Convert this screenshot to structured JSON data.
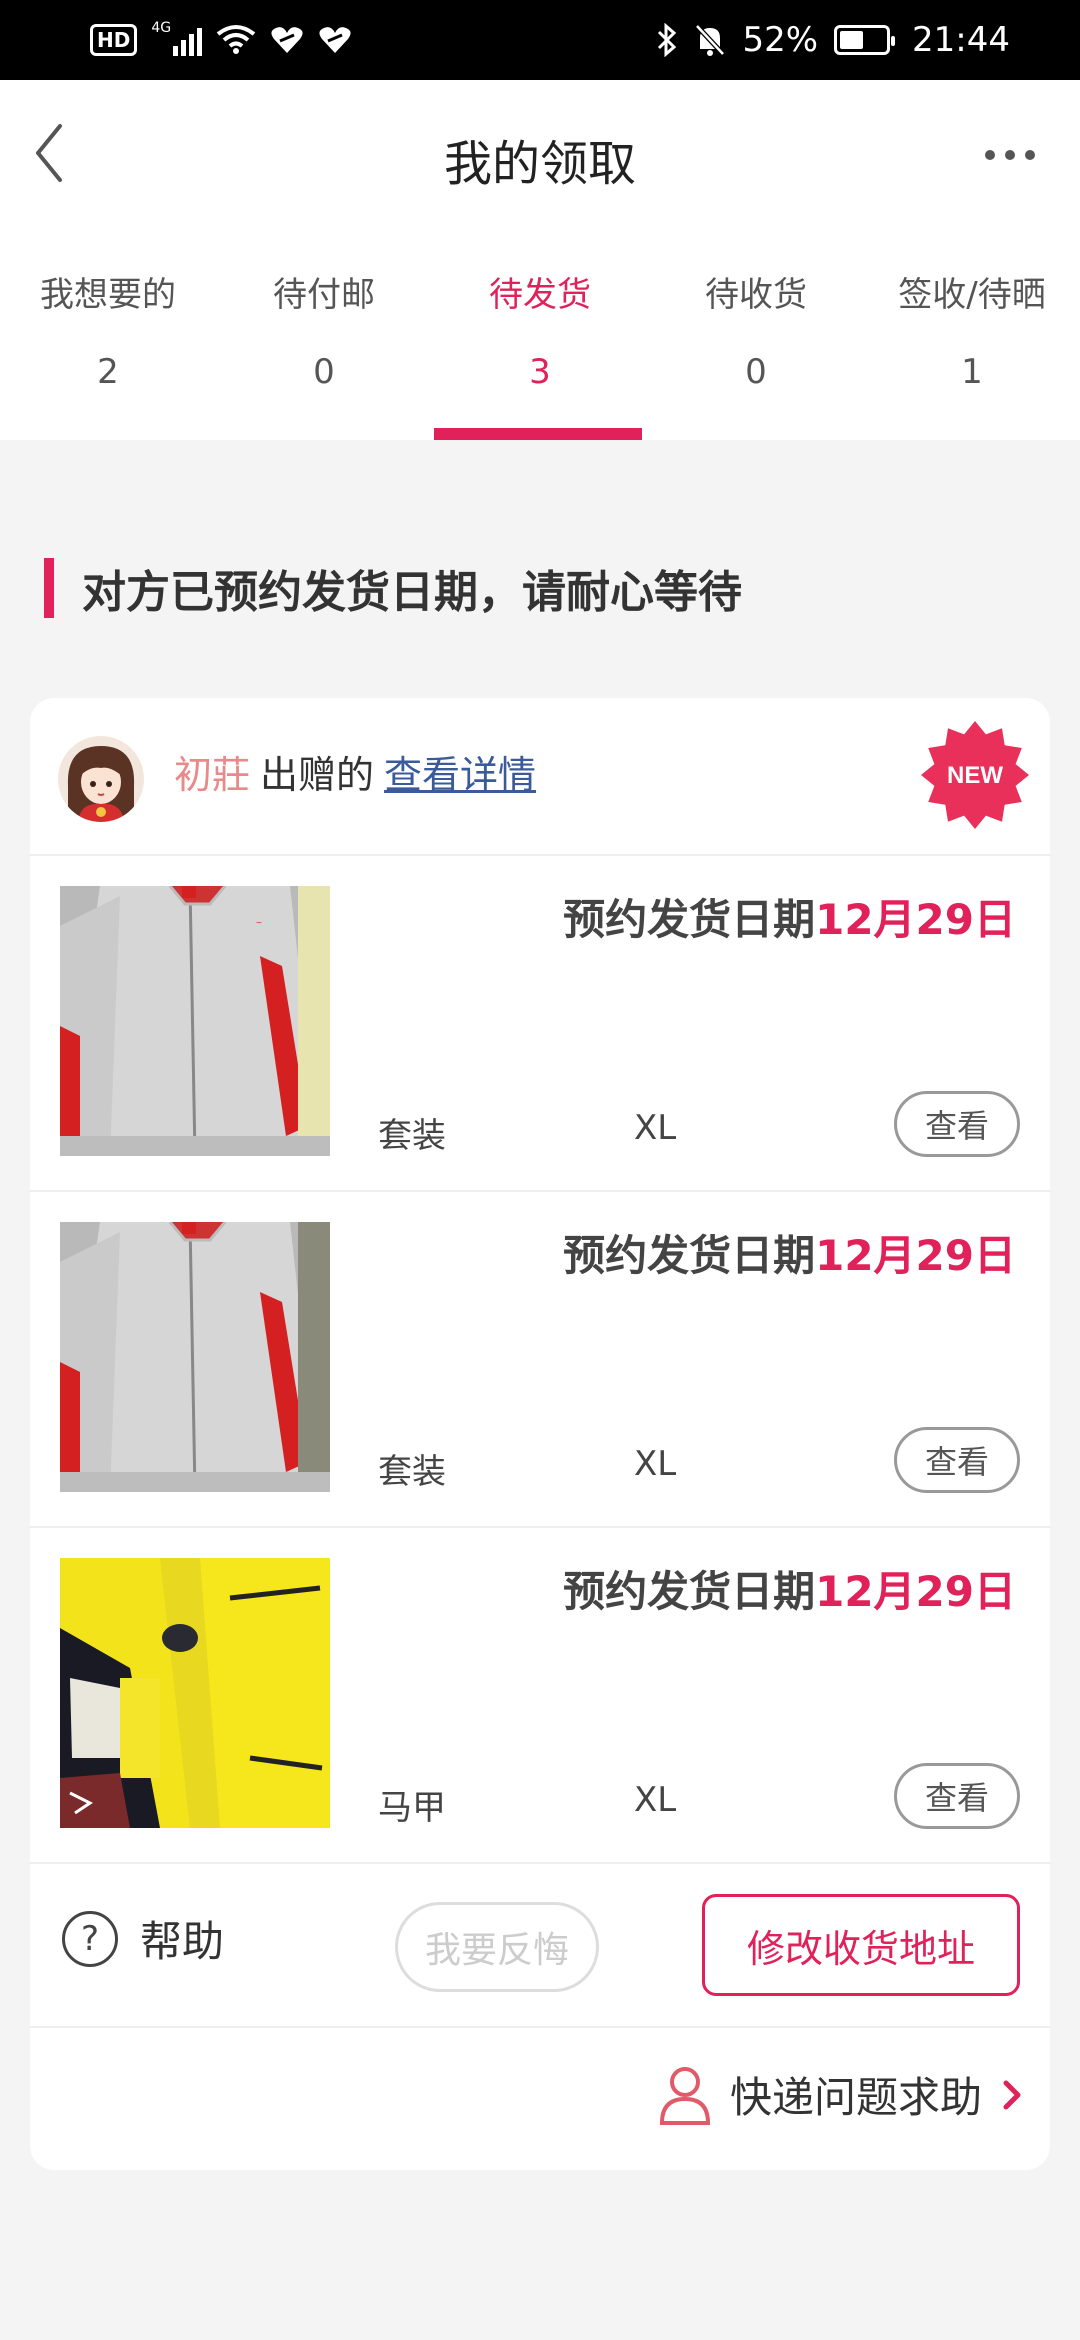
{
  "status_bar": {
    "hd": "HD",
    "network": "4G",
    "battery": "52%",
    "battery_level": 0.52,
    "time": "21:44"
  },
  "header": {
    "title": "我的领取"
  },
  "tabs": [
    {
      "label": "我想要的",
      "count": "2",
      "active": false
    },
    {
      "label": "待付邮",
      "count": "0",
      "active": false
    },
    {
      "label": "待发货",
      "count": "3",
      "active": true
    },
    {
      "label": "待收货",
      "count": "0",
      "active": false
    },
    {
      "label": "签收/待晒",
      "count": "1",
      "active": false
    }
  ],
  "notice": "对方已预约发货日期，请耐心等待",
  "card": {
    "donor_name": "初莊",
    "donor_suffix": "出赠的",
    "details_link": "查看详情",
    "new_badge": "NEW",
    "items": [
      {
        "ship_label": "预约发货日期",
        "ship_date": "12月29日",
        "type": "套装",
        "size": "XL",
        "view_label": "查看",
        "image": "grey-red-jacket"
      },
      {
        "ship_label": "预约发货日期",
        "ship_date": "12月29日",
        "type": "套装",
        "size": "XL",
        "view_label": "查看",
        "image": "grey-red-jacket"
      },
      {
        "ship_label": "预约发货日期",
        "ship_date": "12月29日",
        "type": "马甲",
        "size": "XL",
        "view_label": "查看",
        "image": "yellow-vest"
      }
    ],
    "help_label": "帮助",
    "regret_label": "我要反悔",
    "address_label": "修改收货地址",
    "courier_label": "快递问题求助"
  },
  "colors": {
    "accent": "#e0215a",
    "donor_name": "#e88a8a",
    "link": "#3a5a9a"
  }
}
